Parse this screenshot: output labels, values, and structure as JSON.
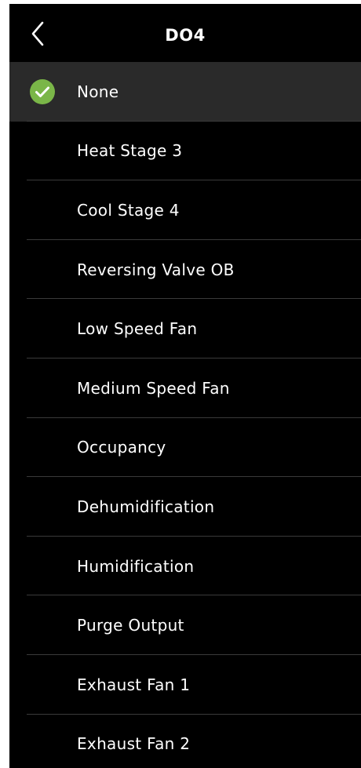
{
  "header": {
    "title": "DO4",
    "back_icon": "chevron-left-icon"
  },
  "colors": {
    "background": "#000000",
    "selected_row": "#2a2a2a",
    "check_green": "#7ab648",
    "text": "#ffffff",
    "divider": "#3a3a3a"
  },
  "options": [
    {
      "label": "None",
      "selected": true
    },
    {
      "label": "Heat Stage 3",
      "selected": false
    },
    {
      "label": "Cool Stage 4",
      "selected": false
    },
    {
      "label": "Reversing Valve OB",
      "selected": false
    },
    {
      "label": "Low Speed Fan",
      "selected": false
    },
    {
      "label": "Medium Speed Fan",
      "selected": false
    },
    {
      "label": "Occupancy",
      "selected": false
    },
    {
      "label": "Dehumidification",
      "selected": false
    },
    {
      "label": "Humidification",
      "selected": false
    },
    {
      "label": "Purge Output",
      "selected": false
    },
    {
      "label": "Exhaust Fan 1",
      "selected": false
    },
    {
      "label": "Exhaust Fan 2",
      "selected": false
    }
  ]
}
